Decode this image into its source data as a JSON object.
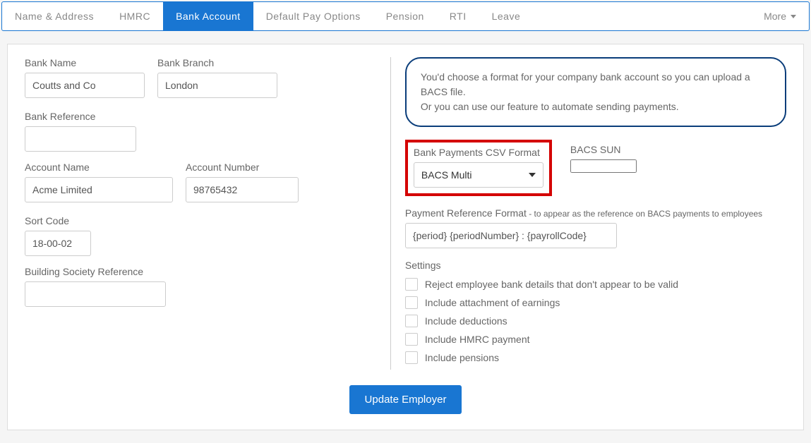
{
  "tabs": {
    "items": [
      "Name & Address",
      "HMRC",
      "Bank Account",
      "Default Pay Options",
      "Pension",
      "RTI",
      "Leave"
    ],
    "more": "More"
  },
  "left": {
    "bank_name_label": "Bank Name",
    "bank_name": "Coutts and Co",
    "bank_branch_label": "Bank Branch",
    "bank_branch": "London",
    "bank_ref_label": "Bank Reference",
    "bank_ref": "",
    "account_name_label": "Account Name",
    "account_name": "Acme Limited",
    "account_number_label": "Account Number",
    "account_number": "98765432",
    "sort_code_label": "Sort Code",
    "sort_code": "18-00-02",
    "bsr_label": "Building Society Reference",
    "bsr": ""
  },
  "right": {
    "info_line1": "You'd choose a format for your company bank account so you can upload a BACS file.",
    "info_line2": "Or you can use our feature to automate sending payments.",
    "csv_format_label": "Bank Payments CSV Format",
    "csv_format_value": "BACS Multi",
    "bacs_sun_label": "BACS SUN",
    "bacs_sun": "",
    "pref_label": "Payment Reference Format",
    "pref_sub": " - to appear as the reference on BACS payments to employees",
    "pref_value": "{period} {periodNumber} : {payrollCode}",
    "settings_label": "Settings",
    "checks": [
      "Reject employee bank details that don't appear to be valid",
      "Include attachment of earnings",
      "Include deductions",
      "Include HMRC payment",
      "Include pensions"
    ]
  },
  "button_label": "Update Employer"
}
